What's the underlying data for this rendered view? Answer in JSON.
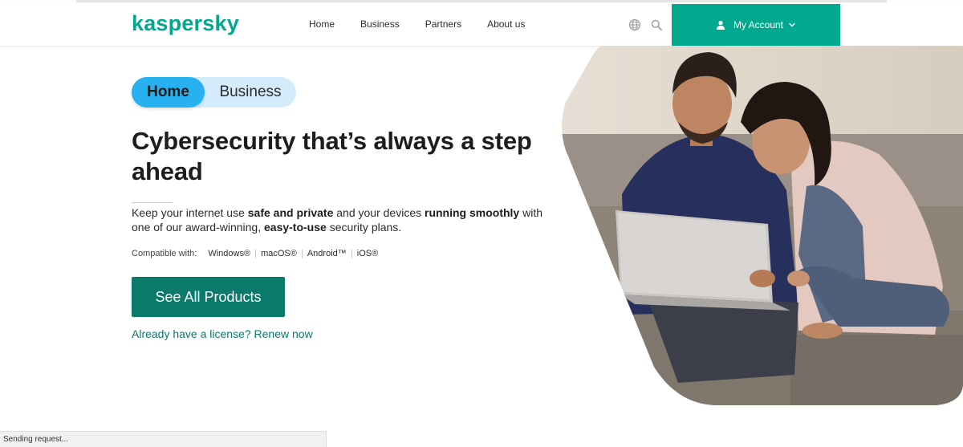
{
  "header": {
    "logo": "kaspersky",
    "nav": [
      "Home",
      "Business",
      "Partners",
      "About us"
    ],
    "globe_icon": "globe-icon",
    "search_icon": "search-icon",
    "account_label": "My Account",
    "account_icon": "user-icon",
    "account_chevron": "chevron-down-icon"
  },
  "toggle": {
    "home": "Home",
    "business": "Business",
    "selected": "Home"
  },
  "hero": {
    "headline": "Cybersecurity that’s always a step ahead",
    "sub": {
      "p1": "Keep your internet use ",
      "b1": "safe and private",
      "p2": " and your devices ",
      "b2": "running smoothly",
      "p3": " with one of our award-winning, ",
      "b3": "easy-to-use",
      "p4": " security plans."
    },
    "compat_label": "Compatible with:",
    "compat_os": [
      "Windows®",
      "macOS®",
      "Android™",
      "iOS®"
    ],
    "cta": "See All Products",
    "renew": "Already have a license? Renew now",
    "image": "couple-on-couch-with-laptop"
  },
  "status_bar": {
    "text": "Sending request..."
  },
  "colors": {
    "brand": "#00a88e",
    "cta": "#0a7a6b",
    "toggle_active": "#27b1f0",
    "toggle_bg": "#d3ebfa"
  }
}
